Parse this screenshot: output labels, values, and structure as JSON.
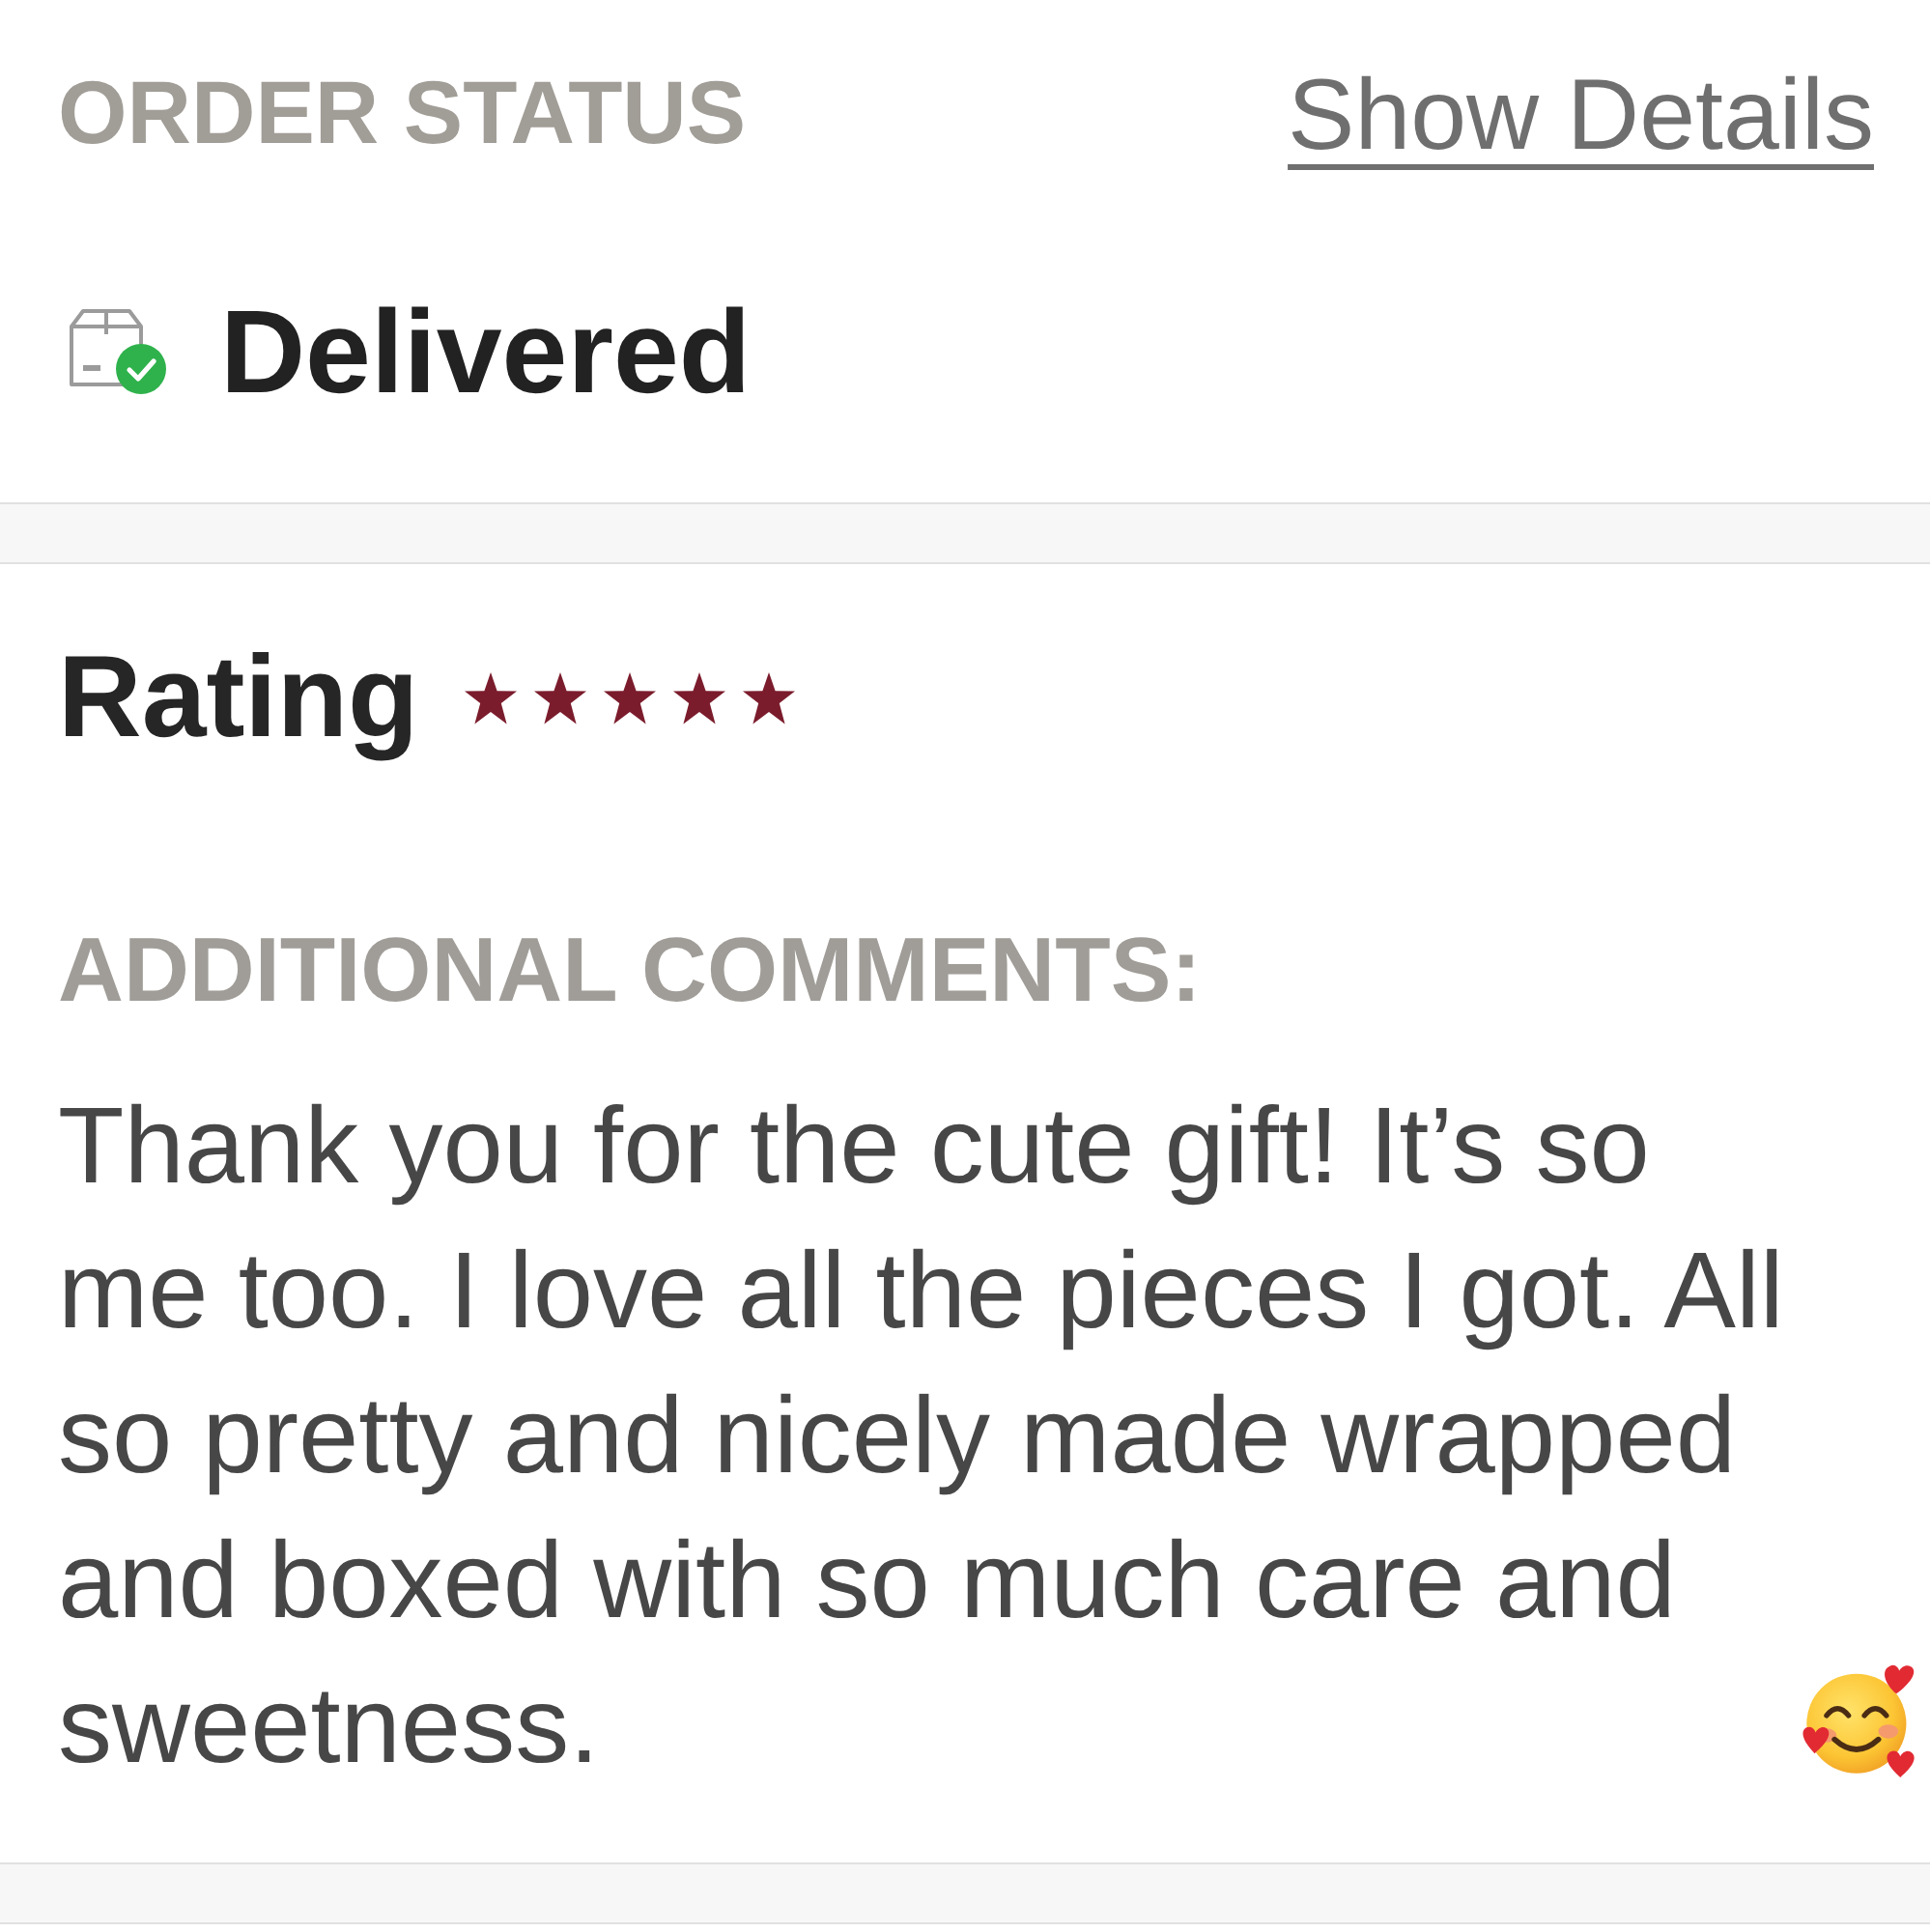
{
  "order_status": {
    "heading": "ORDER STATUS",
    "link": "Show Details",
    "status": "Delivered"
  },
  "rating": {
    "label": "Rating",
    "stars": 5
  },
  "comments": {
    "heading": "ADDITIONAL COMMENTS:",
    "text": "Thank you for the cute gift! It’s so me too. I love all the pieces I got. All so pretty and nicely made wrapped and boxed with so much care and sweetness."
  }
}
